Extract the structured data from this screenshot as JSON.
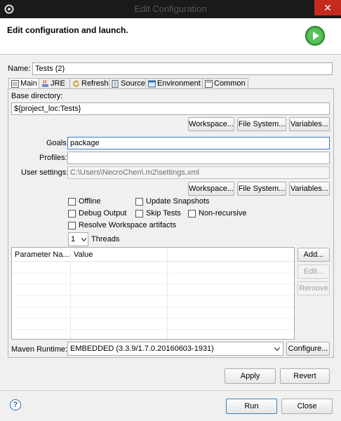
{
  "window": {
    "title": "Edit Configuration",
    "close_glyph": "✕"
  },
  "header": {
    "title": "Edit configuration and launch."
  },
  "name": {
    "label": "Name:",
    "value": "Tests (2)"
  },
  "tabs": [
    {
      "label": "Main",
      "icon": "main-tab-icon"
    },
    {
      "label": "JRE",
      "icon": "jre-icon"
    },
    {
      "label": "Refresh",
      "icon": "refresh-icon"
    },
    {
      "label": "Source",
      "icon": "source-icon"
    },
    {
      "label": "Environment",
      "icon": "environment-icon"
    },
    {
      "label": "Common",
      "icon": "common-icon"
    }
  ],
  "base_directory": {
    "label": "Base directory:",
    "value": "${project_loc:Tests}",
    "buttons": [
      "Workspace...",
      "File System...",
      "Variables..."
    ]
  },
  "goals": {
    "label": "Goals:",
    "value": "package"
  },
  "profiles": {
    "label": "Profiles:",
    "value": ""
  },
  "user_settings": {
    "label": "User settings:",
    "value": "C:\\Users\\NecroChen\\.m2\\settings.xml",
    "buttons": [
      "Workspace...",
      "File System...",
      "Variables..."
    ]
  },
  "options": {
    "offline": {
      "label": "Offline",
      "checked": false
    },
    "update_snapshots": {
      "label": "Update Snapshots",
      "checked": false
    },
    "debug_output": {
      "label": "Debug Output",
      "checked": false
    },
    "skip_tests": {
      "label": "Skip Tests",
      "checked": false
    },
    "non_recursive": {
      "label": "Non-recursive",
      "checked": false
    },
    "resolve_workspace": {
      "label": "Resolve Workspace artifacts",
      "checked": false
    }
  },
  "threads": {
    "value": "1",
    "label": "Threads"
  },
  "parameters": {
    "columns": [
      "Parameter Na...",
      "Value"
    ],
    "rows": [],
    "buttons": {
      "add": "Add...",
      "edit": "Edit...",
      "remove": "Remove"
    }
  },
  "maven_runtime": {
    "label": "Maven Runtime:",
    "value": "EMBEDDED (3.3.9/1.7.0.20160603-1931)",
    "configure": "Configure..."
  },
  "actions": {
    "apply": "Apply",
    "revert": "Revert"
  },
  "footer": {
    "help": "?",
    "run": "Run",
    "close": "Close"
  },
  "colors": {
    "accent": "#3a78c9",
    "close_red": "#c42b1c",
    "run_green": "#2f9e2f"
  }
}
